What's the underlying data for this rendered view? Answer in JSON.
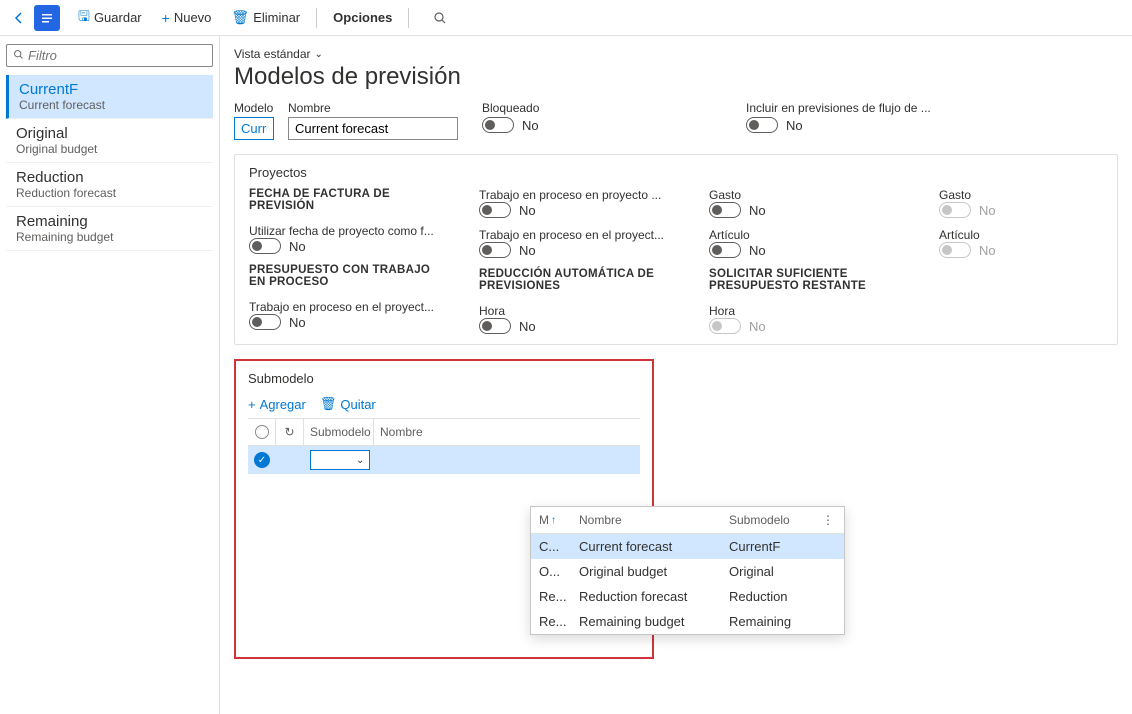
{
  "toolbar": {
    "save": "Guardar",
    "new": "Nuevo",
    "delete": "Eliminar",
    "options": "Opciones"
  },
  "sidebar": {
    "filter_placeholder": "Filtro",
    "items": [
      {
        "title": "CurrentF",
        "sub": "Current forecast"
      },
      {
        "title": "Original",
        "sub": "Original budget"
      },
      {
        "title": "Reduction",
        "sub": "Reduction forecast"
      },
      {
        "title": "Remaining",
        "sub": "Remaining budget"
      }
    ]
  },
  "header": {
    "view": "Vista estándar",
    "title": "Modelos de previsión",
    "modelo_label": "Modelo",
    "modelo_value": "Curre",
    "nombre_label": "Nombre",
    "nombre_value": "Current forecast",
    "bloqueado_label": "Bloqueado",
    "bloqueado_value": "No",
    "incluir_label": "Incluir en previsiones de flujo de ...",
    "incluir_value": "No"
  },
  "proyectos": {
    "title": "Proyectos",
    "col1": {
      "h1": "FECHA DE FACTURA DE PREVISIÓN",
      "l1": "Utilizar fecha de proyecto como f...",
      "v1": "No",
      "h2": "PRESUPUESTO CON TRABAJO EN PROCESO",
      "l2": "Trabajo en proceso en el proyect...",
      "v2": "No"
    },
    "col2": {
      "l1": "Trabajo en proceso en proyecto ...",
      "v1": "No",
      "l2": "Trabajo en proceso en el proyect...",
      "v2": "No",
      "h3": "REDUCCIÓN AUTOMÁTICA DE PREVISIONES",
      "l3": "Hora",
      "v3": "No"
    },
    "col3": {
      "l1": "Gasto",
      "v1": "No",
      "l2": "Artículo",
      "v2": "No",
      "h3": "SOLICITAR SUFICIENTE PRESUPUESTO RESTANTE",
      "l3": "Hora",
      "v3": "No"
    },
    "col4": {
      "l1": "Gasto",
      "v1": "No",
      "l2": "Artículo",
      "v2": "No"
    }
  },
  "submodelo": {
    "title": "Submodelo",
    "add": "Agregar",
    "remove": "Quitar",
    "col_sub": "Submodelo",
    "col_nom": "Nombre"
  },
  "dropdown": {
    "h_m": "M",
    "h_nom": "Nombre",
    "h_sub": "Submodelo",
    "rows": [
      {
        "m": "C...",
        "nom": "Current forecast",
        "sub": "CurrentF"
      },
      {
        "m": "O...",
        "nom": "Original budget",
        "sub": "Original"
      },
      {
        "m": "Re...",
        "nom": "Reduction forecast",
        "sub": "Reduction"
      },
      {
        "m": "Re...",
        "nom": "Remaining budget",
        "sub": "Remaining"
      }
    ]
  }
}
